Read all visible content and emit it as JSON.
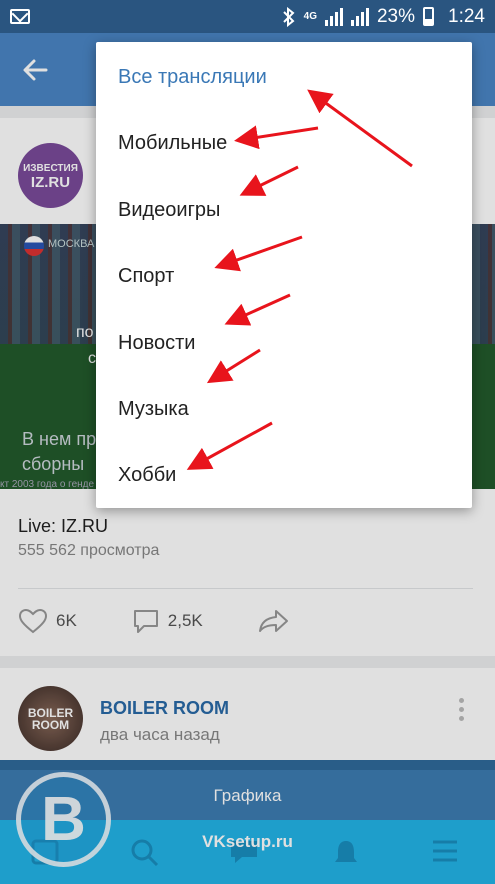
{
  "statusbar": {
    "network": "4G",
    "battery": "23%",
    "time": "1:24"
  },
  "feed": {
    "card1": {
      "channel_logo_top": "ИЗВЕСТИЯ",
      "channel_logo_bottom": "IZ.RU",
      "video_overlay_location": "МОСКВА",
      "video_overlay_line1": "В нем пр",
      "video_overlay_line2": "сборны",
      "video_overlay_caption": "кт 2003 года о генде",
      "video_overlay_partial1": "по",
      "video_overlay_partial2": "с",
      "title": "Live: IZ.RU",
      "views": "555 562 просмотра",
      "likes": "6K",
      "comments": "2,5K"
    },
    "card2": {
      "avatar_text_1": "BOILER",
      "avatar_text_2": "ROOM",
      "name": "BOILER ROOM",
      "time": "два часа назад"
    }
  },
  "menu": {
    "items": [
      {
        "label": "Все трансляции",
        "active": true
      },
      {
        "label": "Мобильные",
        "active": false
      },
      {
        "label": "Видеоигры",
        "active": false
      },
      {
        "label": "Спорт",
        "active": false
      },
      {
        "label": "Новости",
        "active": false
      },
      {
        "label": "Музыка",
        "active": false
      },
      {
        "label": "Хобби",
        "active": false
      }
    ]
  },
  "bottom": {
    "graphics_label": "Графика",
    "site_label": "VKsetup.ru",
    "logo_letter": "B"
  },
  "colors": {
    "accent": "#3a78b6",
    "header": "#4a86c5",
    "annotation_arrow": "#e8141c"
  }
}
